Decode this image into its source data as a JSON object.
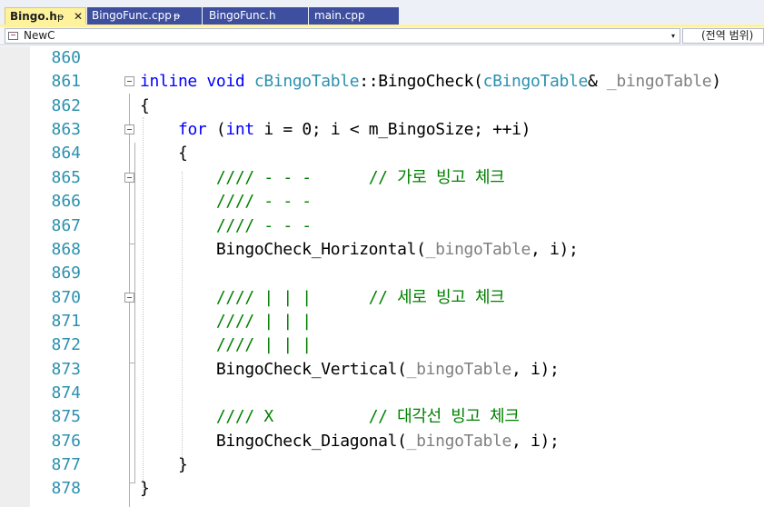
{
  "tabs": [
    {
      "label": "Bingo.h",
      "pin": "ᵽ",
      "close": "✕",
      "active": true
    },
    {
      "label": "BingoFunc.cpp",
      "pin": "ᵽ",
      "active": false
    },
    {
      "label": "BingoFunc.h",
      "active": false
    },
    {
      "label": "main.cpp",
      "active": false
    }
  ],
  "navigation": {
    "scope": "NewC",
    "scope_dropdown": "▾",
    "global_scope": "(전역 범위)"
  },
  "colors": {
    "keyword": "#0000ff",
    "type": "#2b91af",
    "comment": "#008000",
    "line_number": "#2b91af",
    "active_tab": "#fff29d",
    "inactive_tab": "#3e4fa0"
  },
  "editor": {
    "lines": [
      {
        "number": "860"
      },
      {
        "number": "861",
        "t0": "inline",
        "t1": " ",
        "t2": "void",
        "t3": " ",
        "t4": "cBingoTable",
        "t5": "::BingoCheck(",
        "t6": "cBingoTable",
        "t7": "& ",
        "t8": "_bingoTable",
        "t9": ")"
      },
      {
        "number": "862",
        "t0": "{"
      },
      {
        "number": "863",
        "t0": "    ",
        "t1": "for",
        "t2": " (",
        "t3": "int",
        "t4": " ",
        "t5": "i",
        "t6": " = ",
        "t7": "0",
        "t8": "; ",
        "t9": "i",
        "t10": " < m_BingoSize; ++",
        "t11": "i",
        "t12": ")"
      },
      {
        "number": "864",
        "t0": "    {"
      },
      {
        "number": "865",
        "t0": "        ",
        "t1": "//// - - -      // 가로 빙고 체크"
      },
      {
        "number": "866",
        "t0": "        ",
        "t1": "//// - - -"
      },
      {
        "number": "867",
        "t0": "        ",
        "t1": "//// - - -"
      },
      {
        "number": "868",
        "t0": "        BingoCheck_Horizontal(",
        "t1": "_bingoTable",
        "t2": ", ",
        "t3": "i",
        "t4": ");"
      },
      {
        "number": "869"
      },
      {
        "number": "870",
        "t0": "        ",
        "t1": "//// | | |      // 세로 빙고 체크"
      },
      {
        "number": "871",
        "t0": "        ",
        "t1": "//// | | |"
      },
      {
        "number": "872",
        "t0": "        ",
        "t1": "//// | | |"
      },
      {
        "number": "873",
        "t0": "        BingoCheck_Vertical(",
        "t1": "_bingoTable",
        "t2": ", ",
        "t3": "i",
        "t4": ");"
      },
      {
        "number": "874"
      },
      {
        "number": "875",
        "t0": "        ",
        "t1": "//// X          // 대각선 빙고 체크"
      },
      {
        "number": "876",
        "t0": "        BingoCheck_Diagonal(",
        "t1": "_bingoTable",
        "t2": ", ",
        "t3": "i",
        "t4": ");"
      },
      {
        "number": "877",
        "t0": "    }"
      },
      {
        "number": "878",
        "t0": "}"
      }
    ]
  }
}
